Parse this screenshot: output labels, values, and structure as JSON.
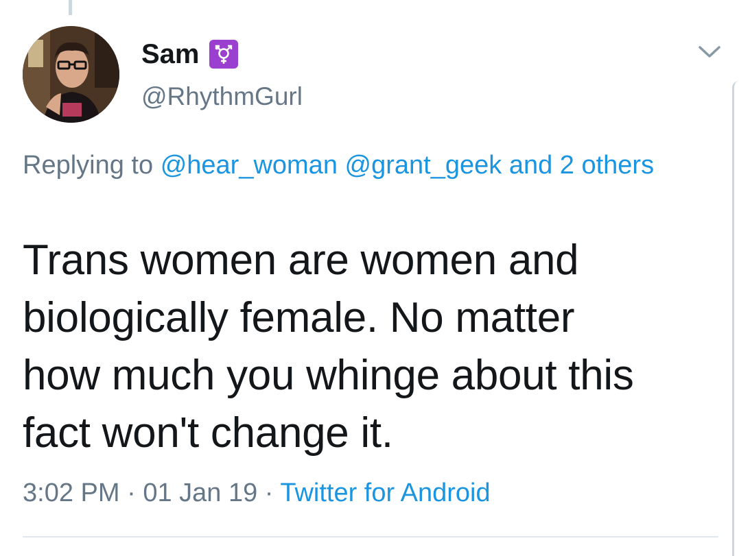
{
  "tweet": {
    "author": {
      "display_name": "Sam",
      "handle": "@RhythmGurl",
      "name_emoji": "⚧",
      "avatar_alt": "profile photo"
    },
    "reply_context": {
      "prefix": "Replying to",
      "mentions": [
        "@hear_woman",
        "@grant_geek"
      ],
      "others": "and 2 others"
    },
    "text_lines": [
      "Trans women are women and",
      "biologically female. No matter",
      "how much you whinge about this",
      "fact won't change it."
    ],
    "time": "3:02 PM",
    "date": "01 Jan 19",
    "separator": "·",
    "source": "Twitter for Android"
  },
  "colors": {
    "text": "#14171a",
    "secondary": "#657786",
    "link": "#1b95e0",
    "badge": "#9b3fd1",
    "divider": "#e1e8ed"
  },
  "icons": {
    "caret": "chevron-down-icon",
    "badge": "transgender-symbol-icon"
  }
}
